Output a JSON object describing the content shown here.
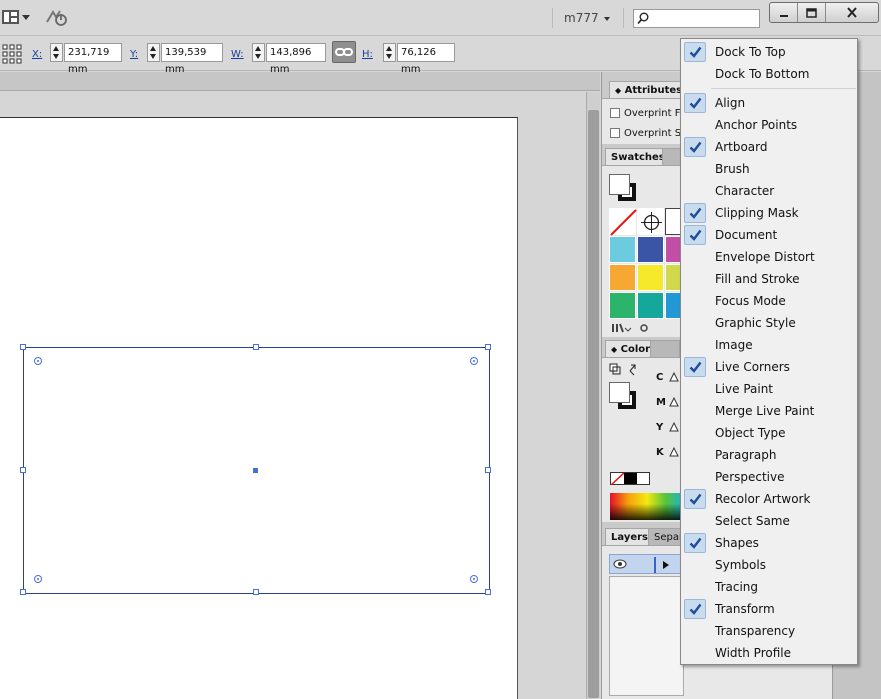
{
  "titlebar": {
    "user_name": "m777",
    "search_value": "",
    "window_buttons": {
      "minimize": "minimize-icon",
      "maximize": "maximize-icon",
      "close": "close-icon"
    }
  },
  "controlbar": {
    "x_label": "X:",
    "x_value": "231,719 mm",
    "y_label": "Y:",
    "y_value": "139,539 mm",
    "w_label": "W:",
    "w_value": "143,896 mm",
    "h_label": "H:",
    "h_value": "76,126 mm"
  },
  "panels": {
    "attributes": {
      "tab_label": "Attributes",
      "overprint_fill": "Overprint Fill",
      "overprint_stroke": "Overprint St"
    },
    "swatches": {
      "tab_label": "Swatches",
      "colors": [
        "#6ccbde",
        "#3a55a6",
        "#c14fa5",
        "#f6a833",
        "#f6e92b",
        "#d0d84b",
        "#2cb46b",
        "#14a89c",
        "#2299d5"
      ]
    },
    "color": {
      "tab_label": "Color",
      "channels": [
        "C",
        "M",
        "Y",
        "K"
      ]
    },
    "layers": {
      "tab_label": "Layers",
      "sep_tab_label": "Separ"
    }
  },
  "window_menu": {
    "group1": [
      {
        "label": "Dock To Top",
        "checked": true
      },
      {
        "label": "Dock To Bottom",
        "checked": false
      }
    ],
    "group2": [
      {
        "label": "Align",
        "checked": true
      },
      {
        "label": "Anchor Points",
        "checked": false
      },
      {
        "label": "Artboard",
        "checked": true
      },
      {
        "label": "Brush",
        "checked": false
      },
      {
        "label": "Character",
        "checked": false
      },
      {
        "label": "Clipping Mask",
        "checked": true
      },
      {
        "label": "Document",
        "checked": true
      },
      {
        "label": "Envelope Distort",
        "checked": false
      },
      {
        "label": "Fill and Stroke",
        "checked": false
      },
      {
        "label": "Focus Mode",
        "checked": false
      },
      {
        "label": "Graphic Style",
        "checked": false
      },
      {
        "label": "Image",
        "checked": false
      },
      {
        "label": "Live Corners",
        "checked": true
      },
      {
        "label": "Live Paint",
        "checked": false
      },
      {
        "label": "Merge Live Paint",
        "checked": false
      },
      {
        "label": "Object Type",
        "checked": false
      },
      {
        "label": "Paragraph",
        "checked": false
      },
      {
        "label": "Perspective",
        "checked": false
      },
      {
        "label": "Recolor Artwork",
        "checked": true
      },
      {
        "label": "Select Same",
        "checked": false
      },
      {
        "label": "Shapes",
        "checked": true
      },
      {
        "label": "Symbols",
        "checked": false
      },
      {
        "label": "Tracing",
        "checked": false
      },
      {
        "label": "Transform",
        "checked": true
      },
      {
        "label": "Transparency",
        "checked": false
      },
      {
        "label": "Width Profile",
        "checked": false
      }
    ]
  },
  "colors": {
    "selection_stroke": "#2b3f9a",
    "handle": "#4a6fd8",
    "menu_check_bg": "#c9dcef",
    "checkmark": "#1f4f9a"
  }
}
